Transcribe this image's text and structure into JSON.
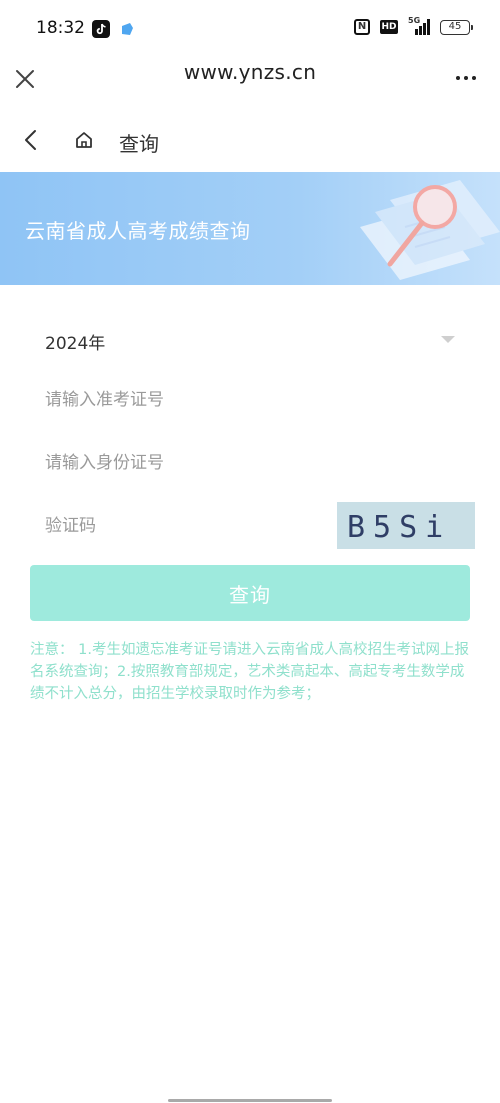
{
  "status_bar": {
    "time": "18:32",
    "app_icons": [
      "tiktok-icon",
      "cloud-app-icon"
    ],
    "nfc_label": "N",
    "hd_label": "HD",
    "network_label": "5G",
    "battery": "45"
  },
  "browser": {
    "url": "www.ynzs.cn",
    "close_icon": "close-icon",
    "menu_icon": "more-icon"
  },
  "nav": {
    "back_icon": "chevron-left-icon",
    "home_icon": "home-icon",
    "title": "查询"
  },
  "banner": {
    "title": "云南省成人高考成绩查询",
    "art_icon": "magnifier-icon"
  },
  "form": {
    "year_selected": "2024年",
    "exam_no_placeholder": "请输入准考证号",
    "id_no_placeholder": "请输入身份证号",
    "captcha_placeholder": "验证码",
    "captcha_text": "B5Si"
  },
  "submit_label": "查询",
  "notice": "注意： 1.考生如遗忘准考证号请进入云南省成人高校招生考试网上报名系统查询；2.按照教育部规定，艺术类高起本、高起专考生数学成绩不计入总分，由招生学校录取时作为参考；",
  "colors": {
    "accent": "#9eeadd",
    "notice": "#8fe0cc",
    "banner": "#8fc4f5"
  }
}
